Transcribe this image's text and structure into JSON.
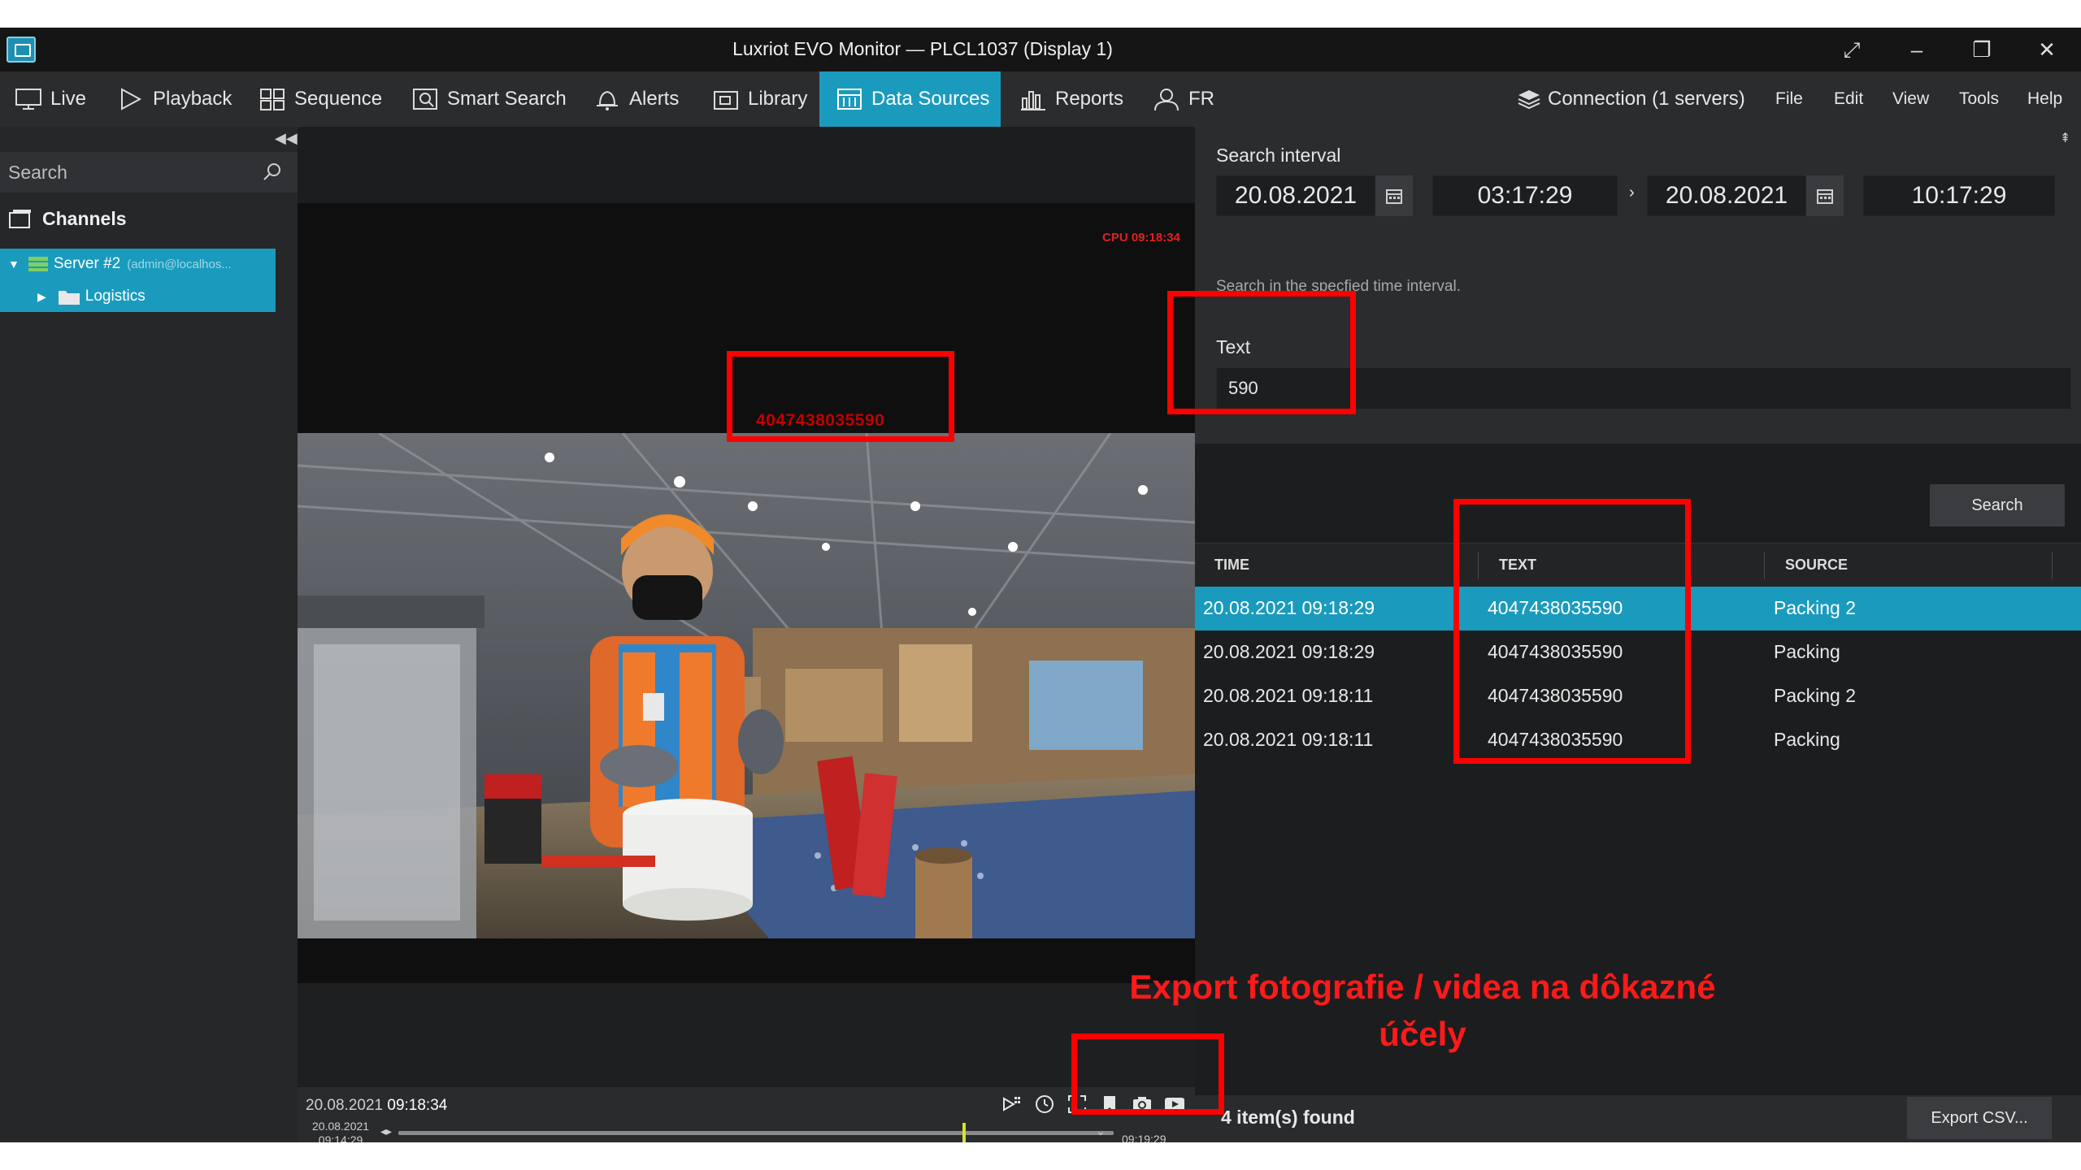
{
  "window": {
    "title": "Luxriot EVO Monitor — PLCL1037 (Display 1)"
  },
  "nav": {
    "items": [
      {
        "label": "Live",
        "icon": "monitor-icon"
      },
      {
        "label": "Playback",
        "icon": "play-icon"
      },
      {
        "label": "Sequence",
        "icon": "grid-icon"
      },
      {
        "label": "Smart Search",
        "icon": "smart-search-icon"
      },
      {
        "label": "Alerts",
        "icon": "bell-icon"
      },
      {
        "label": "Library",
        "icon": "library-icon"
      },
      {
        "label": "Data Sources",
        "icon": "data-sources-icon",
        "active": true
      },
      {
        "label": "Reports",
        "icon": "reports-icon"
      },
      {
        "label": "FR",
        "icon": "person-icon"
      }
    ],
    "connection": "Connection (1 servers)",
    "menu": [
      "File",
      "Edit",
      "View",
      "Tools",
      "Help"
    ]
  },
  "sidebar": {
    "search_placeholder": "Search",
    "channels_label": "Channels",
    "server": "Server #2",
    "server_sub": "(admin@localhos...",
    "folder": "Logistics"
  },
  "video": {
    "cpu_label": "CPU 09:18:34",
    "ocr_text": "4047438035590",
    "timestamp_date": "20.08.2021",
    "timestamp_time": "09:18:34",
    "timeline_start_date": "20.08.2021",
    "timeline_start_time": "09:14:29",
    "timeline_end_time": "09:19:29"
  },
  "search_panel": {
    "interval_label": "Search interval",
    "from_date": "20.08.2021",
    "from_time": "03:17:29",
    "to_date": "20.08.2021",
    "to_time": "10:17:29",
    "interval_hint": "Search in the specfied time interval.",
    "text_label": "Text",
    "text_value": "590",
    "search_button": "Search"
  },
  "results": {
    "columns": [
      "TIME",
      "TEXT",
      "SOURCE"
    ],
    "rows": [
      {
        "time": "20.08.2021 09:18:29",
        "text": "4047438035590",
        "source": "Packing 2",
        "selected": true
      },
      {
        "time": "20.08.2021 09:18:29",
        "text": "4047438035590",
        "source": "Packing"
      },
      {
        "time": "20.08.2021 09:18:11",
        "text": "4047438035590",
        "source": "Packing 2"
      },
      {
        "time": "20.08.2021 09:18:11",
        "text": "4047438035590",
        "source": "Packing"
      }
    ],
    "found_label": "4 item(s) found",
    "export_button": "Export CSV..."
  },
  "annotation": {
    "line1": "Export fotografie / videa na dôkazné",
    "line2": "účely",
    "color": "#ff0000"
  },
  "colors": {
    "accent": "#1a9bbd",
    "cpu_text": "#e02020",
    "timeline_marker": "#d8e030"
  }
}
